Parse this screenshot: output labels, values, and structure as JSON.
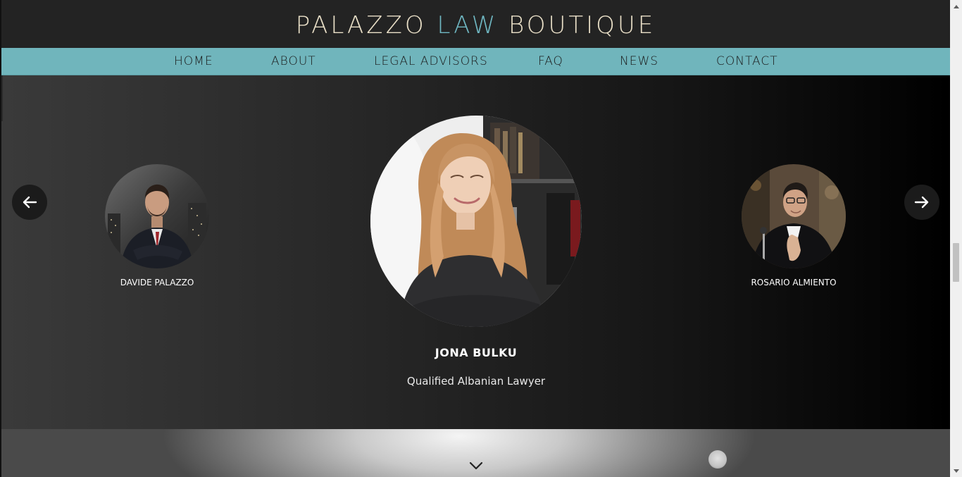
{
  "brand": {
    "part1": "PALAZZO ",
    "part2": "LAW",
    "part3": " BOUTIQUE",
    "accent_color": "#6fb7c2",
    "text_color": "#e9dfc7"
  },
  "nav": {
    "bg_color": "#70b5bc",
    "items": [
      {
        "label": "HOME"
      },
      {
        "label": "ABOUT"
      },
      {
        "label": "LEGAL ADVISORS"
      },
      {
        "label": "FAQ"
      },
      {
        "label": "NEWS"
      },
      {
        "label": "CONTACT"
      }
    ]
  },
  "slider": {
    "prev_icon": "arrow-left-icon",
    "next_icon": "arrow-right-icon",
    "left_person": {
      "name": "DAVIDE PALAZZO"
    },
    "center_person": {
      "name": "JONA BULKU",
      "role": "Qualified Albanian Lawyer"
    },
    "right_person": {
      "name": "ROSARIO ALMIENTO"
    }
  },
  "bottom": {
    "scroll_icon": "chevron-down-icon"
  }
}
